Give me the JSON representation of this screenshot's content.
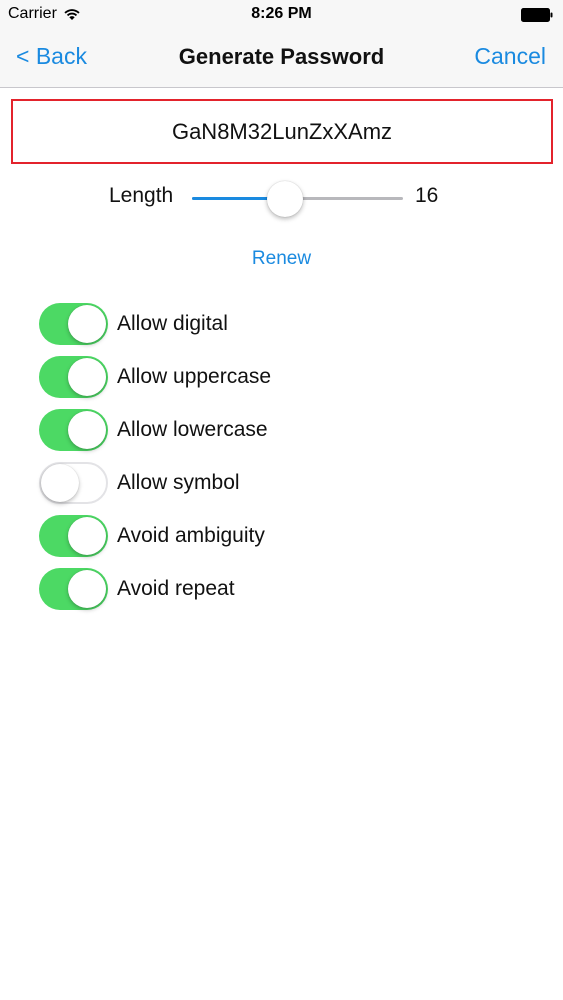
{
  "status_bar": {
    "carrier": "Carrier",
    "time": "8:26 PM",
    "wifi_icon": "wifi-icon",
    "battery_icon": "battery-icon"
  },
  "nav": {
    "back_label": "< Back",
    "title": "Generate Password",
    "cancel_label": "Cancel"
  },
  "password": {
    "value": "GaN8M32LunZxXAmz"
  },
  "length": {
    "label": "Length",
    "value": "16",
    "slider_fraction": 0.44
  },
  "renew_label": "Renew",
  "options": [
    {
      "label": "Allow digital",
      "on": true
    },
    {
      "label": "Allow uppercase",
      "on": true
    },
    {
      "label": "Allow lowercase",
      "on": true
    },
    {
      "label": "Allow symbol",
      "on": false
    },
    {
      "label": "Avoid ambiguity",
      "on": true
    },
    {
      "label": "Avoid repeat",
      "on": true
    }
  ],
  "colors": {
    "accent": "#1a8ae0",
    "switch_on": "#4cd964",
    "password_border": "#e3232c"
  }
}
